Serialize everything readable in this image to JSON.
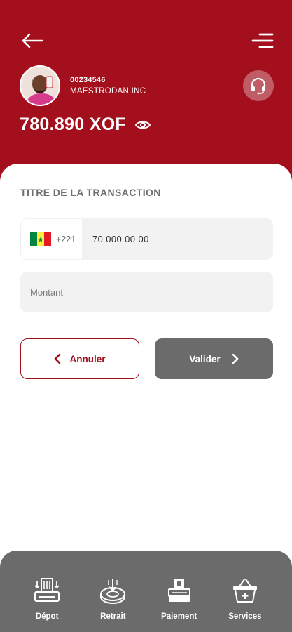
{
  "header": {
    "account_number": "00234546",
    "account_name": "MAESTRODAN INC",
    "balance": "780.890 XOF",
    "background_color": "#a30f1d"
  },
  "icons": {
    "back": "arrow-left-icon",
    "menu": "menu-icon",
    "support": "headset-icon",
    "visibility": "eye-icon"
  },
  "form": {
    "title": "TITRE DE LA TRANSACTION",
    "country_code": "+221",
    "country_flag": "senegal-flag",
    "phone_value": "70 000 00 00",
    "amount_placeholder": "Montant"
  },
  "actions": {
    "cancel_label": "Annuler",
    "validate_label": "Valider",
    "cancel_color": "#a30f1d",
    "validate_color": "#6b6b6b"
  },
  "bottom_nav": {
    "items": [
      {
        "label": "Dépot",
        "icon": "deposit-icon"
      },
      {
        "label": "Retrait",
        "icon": "withdraw-icon"
      },
      {
        "label": "Paiement",
        "icon": "payment-icon"
      },
      {
        "label": "Services",
        "icon": "basket-icon"
      }
    ]
  }
}
